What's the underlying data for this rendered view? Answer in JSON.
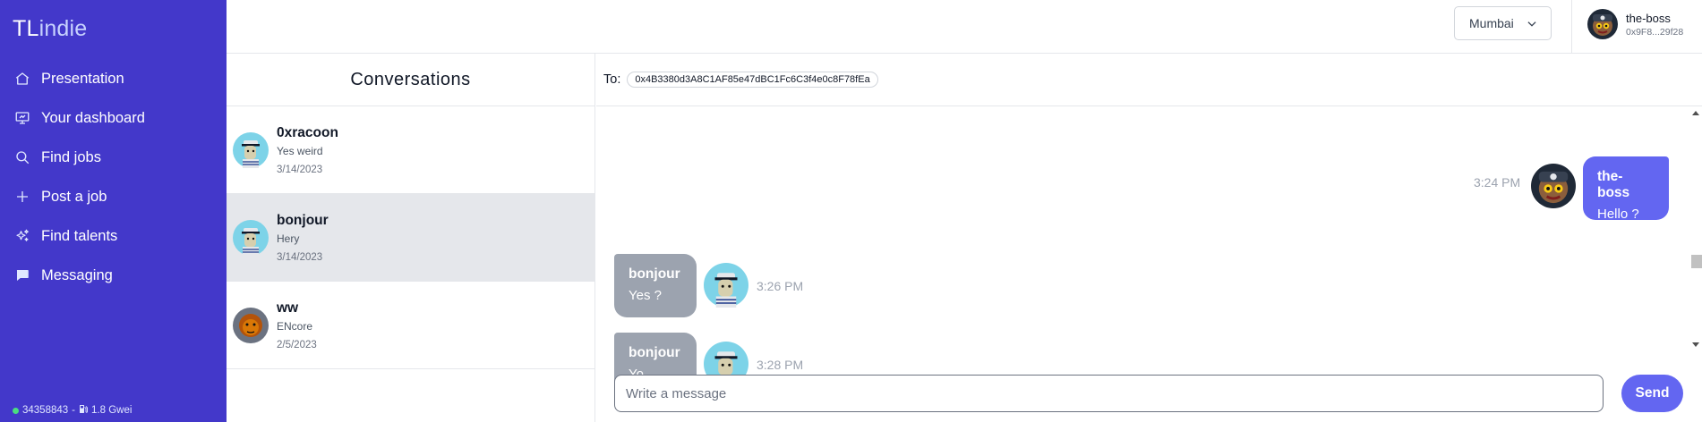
{
  "app": {
    "logo_bold": "TL",
    "logo_light": "indie"
  },
  "sidebar": {
    "items": [
      {
        "label": "Presentation",
        "icon": "home-icon"
      },
      {
        "label": "Your dashboard",
        "icon": "dashboard-icon"
      },
      {
        "label": "Find jobs",
        "icon": "search-icon"
      },
      {
        "label": "Post a job",
        "icon": "plus-icon"
      },
      {
        "label": "Find talents",
        "icon": "sparkles-icon"
      },
      {
        "label": "Messaging",
        "icon": "chat-bubble-icon"
      }
    ],
    "footer": {
      "block": "34358843",
      "separator": "-",
      "gas": "1.8 Gwei",
      "status_color": "#4ade80"
    }
  },
  "header": {
    "network": "Mumbai",
    "user": {
      "name": "the-boss",
      "address": "0x9F8...29f28"
    }
  },
  "conversations": {
    "title": "Conversations",
    "items": [
      {
        "name": "0xracoon",
        "last_message": "Yes weird",
        "date": "3/14/2023",
        "active": false
      },
      {
        "name": "bonjour",
        "last_message": "Hery",
        "date": "3/14/2023",
        "active": true
      },
      {
        "name": "ww",
        "last_message": "ENcore",
        "date": "2/5/2023",
        "active": false
      }
    ]
  },
  "chat": {
    "to_label": "To:",
    "to_address": "0x4B3380d3A8C1AF85e47dBC1Fc6C3f4e0c8F78fEa",
    "messages": [
      {
        "sender": "the-boss",
        "text": "Hello ?",
        "time": "3:24 PM",
        "mine": true
      },
      {
        "sender": "bonjour",
        "text": "Yes ?",
        "time": "3:26 PM",
        "mine": false
      },
      {
        "sender": "bonjour",
        "text": "Yo",
        "time": "3:28 PM",
        "mine": false
      }
    ],
    "input_placeholder": "Write a message",
    "send_label": "Send"
  },
  "colors": {
    "sidebar": "#4338ca",
    "accent": "#6366f1",
    "other_bubble": "#9ca3af",
    "active_conversation": "#e5e7eb"
  }
}
